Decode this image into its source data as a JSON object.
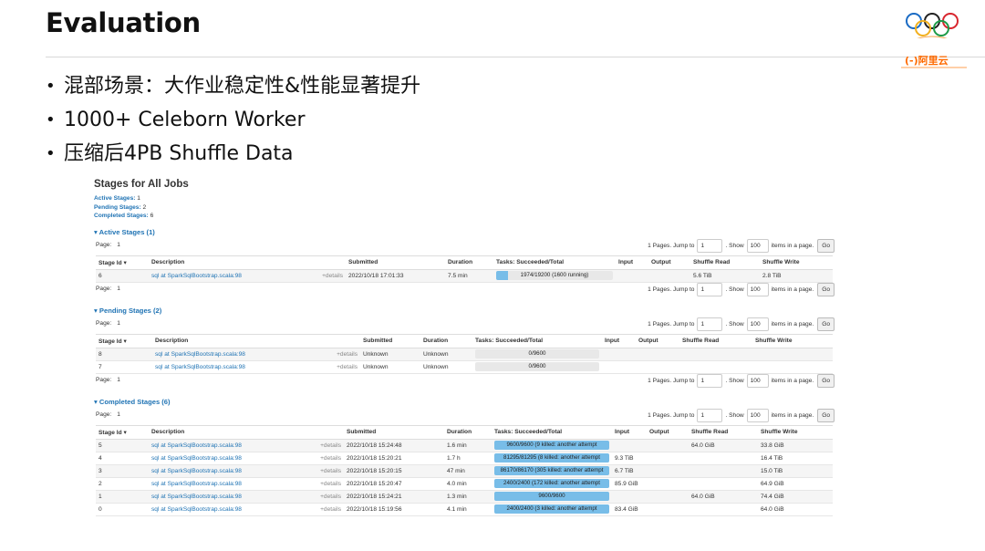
{
  "slide": {
    "title": "Evaluation",
    "bullets": [
      "混部场景：大作业稳定性&性能显著提升",
      "1000+ Celeborn Worker",
      "压缩后4PB Shuffle Data"
    ],
    "logo_text": "(-)阿里云"
  },
  "ui": {
    "title": "Stages for All Jobs",
    "summary": [
      {
        "label": "Active Stages:",
        "value": "1"
      },
      {
        "label": "Pending Stages:",
        "value": "2"
      },
      {
        "label": "Completed Stages:",
        "value": "6"
      }
    ],
    "pager": {
      "page_label": "Page:",
      "page_value": "1",
      "pages_text": "1 Pages. Jump to",
      "jump_value": "1",
      "show_label": ". Show",
      "show_value": "100",
      "items_label": "items in a page.",
      "go_label": "Go"
    },
    "headers": {
      "stage_id": "Stage Id ▾",
      "description": "Description",
      "submitted": "Submitted",
      "duration": "Duration",
      "tasks": "Tasks: Succeeded/Total",
      "input": "Input",
      "output": "Output",
      "shuffle_read": "Shuffle Read",
      "shuffle_write": "Shuffle Write"
    },
    "active": {
      "heading": "▾ Active Stages (1)",
      "rows": [
        {
          "id": "6",
          "desc": "sql at SparkSqlBootstrap.scala:98",
          "details": "+details",
          "submitted": "2022/10/18 17:01:33",
          "duration": "7.5 min",
          "tasks": "1974/19200 (1600 running)",
          "progress": 0.103,
          "input": "",
          "output": "",
          "shuffle_read": "5.6 TiB",
          "shuffle_write": "2.8 TiB"
        }
      ]
    },
    "pending": {
      "heading": "▾ Pending Stages (2)",
      "rows": [
        {
          "id": "8",
          "desc": "sql at SparkSqlBootstrap.scala:98",
          "details": "+details",
          "submitted": "Unknown",
          "duration": "Unknown",
          "tasks": "0/9600",
          "progress": 0,
          "input": "",
          "output": "",
          "shuffle_read": "",
          "shuffle_write": ""
        },
        {
          "id": "7",
          "desc": "sql at SparkSqlBootstrap.scala:98",
          "details": "+details",
          "submitted": "Unknown",
          "duration": "Unknown",
          "tasks": "0/9600",
          "progress": 0,
          "input": "",
          "output": "",
          "shuffle_read": "",
          "shuffle_write": ""
        }
      ]
    },
    "completed": {
      "heading": "▾ Completed Stages (6)",
      "rows": [
        {
          "id": "5",
          "desc": "sql at SparkSqlBootstrap.scala:98",
          "details": "+details",
          "submitted": "2022/10/18 15:24:48",
          "duration": "1.6 min",
          "tasks": "9600/9600 (9 killed: another attempt",
          "progress": 1,
          "input": "",
          "output": "",
          "shuffle_read": "64.0 GiB",
          "shuffle_write": "33.8 GiB"
        },
        {
          "id": "4",
          "desc": "sql at SparkSqlBootstrap.scala:98",
          "details": "+details",
          "submitted": "2022/10/18 15:20:21",
          "duration": "1.7 h",
          "tasks": "81295/81295 (8 killed: another attempt",
          "progress": 1,
          "input": "9.3 TiB",
          "output": "",
          "shuffle_read": "",
          "shuffle_write": "16.4 TiB"
        },
        {
          "id": "3",
          "desc": "sql at SparkSqlBootstrap.scala:98",
          "details": "+details",
          "submitted": "2022/10/18 15:20:15",
          "duration": "47 min",
          "tasks": "86170/86170 (305 killed: another attempt",
          "progress": 1,
          "input": "6.7 TiB",
          "output": "",
          "shuffle_read": "",
          "shuffle_write": "15.0 TiB"
        },
        {
          "id": "2",
          "desc": "sql at SparkSqlBootstrap.scala:98",
          "details": "+details",
          "submitted": "2022/10/18 15:20:47",
          "duration": "4.0 min",
          "tasks": "2400/2400 (172 killed: another attempt",
          "progress": 1,
          "input": "85.9 GiB",
          "output": "",
          "shuffle_read": "",
          "shuffle_write": "64.9 GiB"
        },
        {
          "id": "1",
          "desc": "sql at SparkSqlBootstrap.scala:98",
          "details": "+details",
          "submitted": "2022/10/18 15:24:21",
          "duration": "1.3 min",
          "tasks": "9600/9600",
          "progress": 1,
          "input": "",
          "output": "",
          "shuffle_read": "64.0 GiB",
          "shuffle_write": "74.4 GiB"
        },
        {
          "id": "0",
          "desc": "sql at SparkSqlBootstrap.scala:98",
          "details": "+details",
          "submitted": "2022/10/18 15:19:56",
          "duration": "4.1 min",
          "tasks": "2400/2400 (3 killed: another attempt",
          "progress": 1,
          "input": "83.4 GiB",
          "output": "",
          "shuffle_read": "",
          "shuffle_write": "64.0 GiB"
        }
      ]
    }
  }
}
